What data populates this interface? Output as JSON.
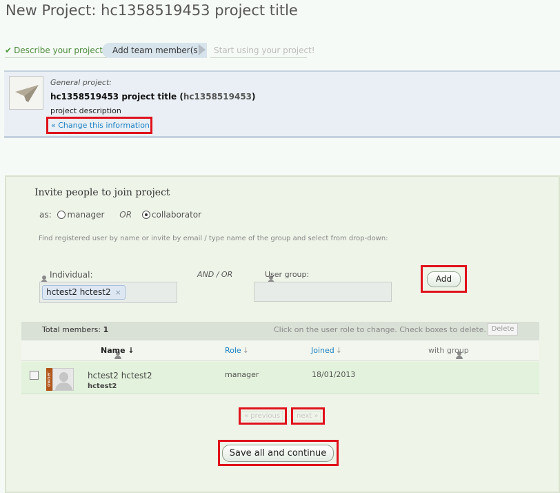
{
  "page": {
    "title": "New Project: hc1358519453 project title"
  },
  "steps": [
    {
      "label": "Describe your project",
      "state": "done"
    },
    {
      "label": "Add team member(s)",
      "state": "active"
    },
    {
      "label": "Start using your project!",
      "state": "upcoming"
    }
  ],
  "project": {
    "label": "General project:",
    "title": "hc1358519453 project title",
    "code": "hc1358519453",
    "description": "project description",
    "change_link": "« Change this information"
  },
  "invite": {
    "title": "Invite people to join project",
    "as_label": "as:",
    "role_manager": "manager",
    "or_label": "OR",
    "role_collaborator": "collaborator",
    "selected_role": "collaborator",
    "hint": "Find registered user by name or invite by email / type name of the group and select from drop-down:",
    "individual_label": "Individual:",
    "individual_chip": "hctest2 hctest2",
    "andor_label": "AND / OR",
    "group_label": "User group:",
    "group_value": "",
    "add_button": "Add"
  },
  "members": {
    "total_label": "Total members:",
    "total_count": "1",
    "hint": "Click on the user role to change. Check boxes to delete.",
    "delete_button": "Delete",
    "columns": {
      "name": "Name",
      "role": "Role",
      "joined": "Joined",
      "group": "with group"
    },
    "rows": [
      {
        "owner_tag": "owner",
        "name": "hctest2 hctest2",
        "username": "hctest2",
        "role": "manager",
        "joined": "18/01/2013",
        "group": ""
      }
    ]
  },
  "pagination": {
    "previous": "« previous",
    "next": "next »"
  },
  "save_button": "Save all and continue",
  "colors": {
    "highlight": "#e0101a",
    "link": "#1a7fc4",
    "step_done": "#4a8a3a"
  }
}
